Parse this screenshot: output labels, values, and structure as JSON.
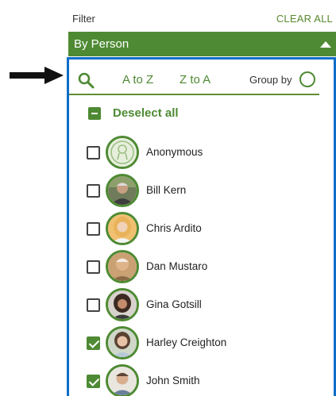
{
  "filter": {
    "title": "Filter",
    "clear_all": "CLEAR ALL"
  },
  "section": {
    "title": "By Person",
    "expanded": true,
    "caret_icon": "caret-up-icon"
  },
  "toolbar": {
    "search_icon": "search-icon",
    "sort_az": "A to Z",
    "sort_za": "Z to A",
    "group_by_label": "Group by",
    "group_by_enabled": false
  },
  "deselect_all": {
    "label": "Deselect all"
  },
  "people": [
    {
      "name": "Anonymous",
      "checked": false,
      "avatar": "anonymous-avatar"
    },
    {
      "name": "Bill Kern",
      "checked": false,
      "avatar": "photo"
    },
    {
      "name": "Chris Ardito",
      "checked": false,
      "avatar": "photo"
    },
    {
      "name": "Dan Mustaro",
      "checked": false,
      "avatar": "photo"
    },
    {
      "name": "Gina Gotsill",
      "checked": false,
      "avatar": "photo"
    },
    {
      "name": "Harley Creighton",
      "checked": true,
      "avatar": "photo"
    },
    {
      "name": "John Smith",
      "checked": true,
      "avatar": "photo"
    }
  ],
  "colors": {
    "accent_green": "#4e8a33",
    "highlight_blue": "#0d6ec9",
    "pointer_arrow": "#111111"
  }
}
